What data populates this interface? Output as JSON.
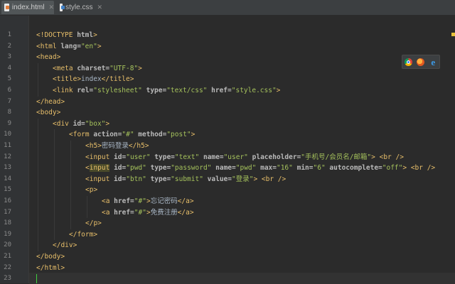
{
  "tabs": [
    {
      "label": "index.html",
      "active": true,
      "file_type": "html"
    },
    {
      "label": "style.css",
      "active": false,
      "file_type": "css"
    }
  ],
  "browser_icons": [
    "chrome-icon",
    "firefox-icon",
    "ie-icon"
  ],
  "current_line": 23,
  "lines": [
    {
      "no": "1",
      "indent": 0,
      "tokens": [
        {
          "t": "doctype",
          "v": "<!DOCTYPE "
        },
        {
          "t": "attr",
          "v": "html"
        },
        {
          "t": "doctype",
          "v": ">"
        }
      ]
    },
    {
      "no": "2",
      "indent": 0,
      "tokens": [
        {
          "t": "tag",
          "v": "<html "
        },
        {
          "t": "attr",
          "v": "lang="
        },
        {
          "t": "val",
          "v": "\"en\""
        },
        {
          "t": "tag",
          "v": ">"
        }
      ]
    },
    {
      "no": "3",
      "indent": 0,
      "tokens": [
        {
          "t": "tag",
          "v": "<head>"
        }
      ]
    },
    {
      "no": "4",
      "indent": 1,
      "tokens": [
        {
          "t": "tag",
          "v": "<meta "
        },
        {
          "t": "attr",
          "v": "charset="
        },
        {
          "t": "val",
          "v": "\"UTF-8\""
        },
        {
          "t": "tag",
          "v": ">"
        }
      ]
    },
    {
      "no": "5",
      "indent": 1,
      "tokens": [
        {
          "t": "tag",
          "v": "<title>"
        },
        {
          "t": "text",
          "v": "index"
        },
        {
          "t": "tag",
          "v": "</title>"
        }
      ]
    },
    {
      "no": "6",
      "indent": 1,
      "tokens": [
        {
          "t": "tag",
          "v": "<link "
        },
        {
          "t": "attr",
          "v": "rel="
        },
        {
          "t": "val",
          "v": "\"stylesheet\""
        },
        {
          "t": "text",
          "v": " "
        },
        {
          "t": "attr",
          "v": "type="
        },
        {
          "t": "val",
          "v": "\"text/css\""
        },
        {
          "t": "text",
          "v": " "
        },
        {
          "t": "attr",
          "v": "href="
        },
        {
          "t": "val",
          "v": "\"style.css\""
        },
        {
          "t": "tag",
          "v": ">"
        }
      ]
    },
    {
      "no": "7",
      "indent": 0,
      "tokens": [
        {
          "t": "tag",
          "v": "</head>"
        }
      ]
    },
    {
      "no": "8",
      "indent": 0,
      "tokens": [
        {
          "t": "tag",
          "v": "<body>"
        }
      ]
    },
    {
      "no": "9",
      "indent": 1,
      "tokens": [
        {
          "t": "tag",
          "v": "<div "
        },
        {
          "t": "attr",
          "v": "id="
        },
        {
          "t": "val",
          "v": "\"box\""
        },
        {
          "t": "tag",
          "v": ">"
        }
      ]
    },
    {
      "no": "10",
      "indent": 2,
      "tokens": [
        {
          "t": "tag",
          "v": "<form "
        },
        {
          "t": "attr",
          "v": "action="
        },
        {
          "t": "val",
          "v": "\"#\""
        },
        {
          "t": "text",
          "v": " "
        },
        {
          "t": "attr",
          "v": "method="
        },
        {
          "t": "val",
          "v": "\"post\""
        },
        {
          "t": "tag",
          "v": ">"
        }
      ]
    },
    {
      "no": "11",
      "indent": 3,
      "tokens": [
        {
          "t": "tag",
          "v": "<h5>"
        },
        {
          "t": "text",
          "v": "密码登录"
        },
        {
          "t": "tag",
          "v": "</h5>"
        }
      ]
    },
    {
      "no": "12",
      "indent": 3,
      "tokens": [
        {
          "t": "tag",
          "v": "<input "
        },
        {
          "t": "attr",
          "v": "id="
        },
        {
          "t": "val",
          "v": "\"user\""
        },
        {
          "t": "text",
          "v": " "
        },
        {
          "t": "attr",
          "v": "type="
        },
        {
          "t": "val",
          "v": "\"text\""
        },
        {
          "t": "text",
          "v": " "
        },
        {
          "t": "attr",
          "v": "name="
        },
        {
          "t": "val",
          "v": "\"user\""
        },
        {
          "t": "text",
          "v": " "
        },
        {
          "t": "attr",
          "v": "placeholder="
        },
        {
          "t": "val",
          "v": "\"手机号/会员名/邮箱\""
        },
        {
          "t": "tag",
          "v": "> <br />"
        }
      ]
    },
    {
      "no": "13",
      "indent": 3,
      "tokens": [
        {
          "t": "tag",
          "v": "<"
        },
        {
          "t": "hltag",
          "v": "input"
        },
        {
          "t": "text",
          "v": " "
        },
        {
          "t": "attr",
          "v": "id="
        },
        {
          "t": "val",
          "v": "\"pwd\""
        },
        {
          "t": "text",
          "v": " "
        },
        {
          "t": "attr",
          "v": "type="
        },
        {
          "t": "val",
          "v": "\"password\""
        },
        {
          "t": "text",
          "v": " "
        },
        {
          "t": "attr",
          "v": "name="
        },
        {
          "t": "val",
          "v": "\"pwd\""
        },
        {
          "t": "text",
          "v": " "
        },
        {
          "t": "attr",
          "v": "max="
        },
        {
          "t": "val",
          "v": "\"16\""
        },
        {
          "t": "text",
          "v": " "
        },
        {
          "t": "attr",
          "v": "min="
        },
        {
          "t": "val",
          "v": "\"6\""
        },
        {
          "t": "text",
          "v": " "
        },
        {
          "t": "attr",
          "v": "autocomplete="
        },
        {
          "t": "val",
          "v": "\"off\""
        },
        {
          "t": "tag",
          "v": "> <br />"
        }
      ]
    },
    {
      "no": "14",
      "indent": 3,
      "tokens": [
        {
          "t": "tag",
          "v": "<input "
        },
        {
          "t": "attr",
          "v": "id="
        },
        {
          "t": "val",
          "v": "\"btn\""
        },
        {
          "t": "text",
          "v": " "
        },
        {
          "t": "attr",
          "v": "type="
        },
        {
          "t": "val",
          "v": "\"submit\""
        },
        {
          "t": "text",
          "v": " "
        },
        {
          "t": "attr",
          "v": "value="
        },
        {
          "t": "val",
          "v": "\"登录\""
        },
        {
          "t": "tag",
          "v": "> <br />"
        }
      ]
    },
    {
      "no": "15",
      "indent": 3,
      "tokens": [
        {
          "t": "tag",
          "v": "<p>"
        }
      ]
    },
    {
      "no": "16",
      "indent": 4,
      "tokens": [
        {
          "t": "tag",
          "v": "<a "
        },
        {
          "t": "attr",
          "v": "href="
        },
        {
          "t": "val",
          "v": "\"#\""
        },
        {
          "t": "tag",
          "v": ">"
        },
        {
          "t": "text",
          "v": "忘记密码"
        },
        {
          "t": "tag",
          "v": "</a>"
        }
      ]
    },
    {
      "no": "17",
      "indent": 4,
      "tokens": [
        {
          "t": "tag",
          "v": "<a "
        },
        {
          "t": "attr",
          "v": "href="
        },
        {
          "t": "val",
          "v": "\"#\""
        },
        {
          "t": "tag",
          "v": ">"
        },
        {
          "t": "text",
          "v": "免费注册"
        },
        {
          "t": "tag",
          "v": "</a>"
        }
      ]
    },
    {
      "no": "18",
      "indent": 3,
      "tokens": [
        {
          "t": "tag",
          "v": "</p>"
        }
      ]
    },
    {
      "no": "19",
      "indent": 2,
      "tokens": [
        {
          "t": "tag",
          "v": "</form>"
        }
      ]
    },
    {
      "no": "20",
      "indent": 1,
      "tokens": [
        {
          "t": "tag",
          "v": "</div>"
        }
      ]
    },
    {
      "no": "21",
      "indent": 0,
      "tokens": [
        {
          "t": "tag",
          "v": "</body>"
        }
      ]
    },
    {
      "no": "22",
      "indent": 0,
      "tokens": [
        {
          "t": "tag",
          "v": "</html>"
        }
      ]
    },
    {
      "no": "23",
      "indent": 0,
      "tokens": []
    }
  ]
}
